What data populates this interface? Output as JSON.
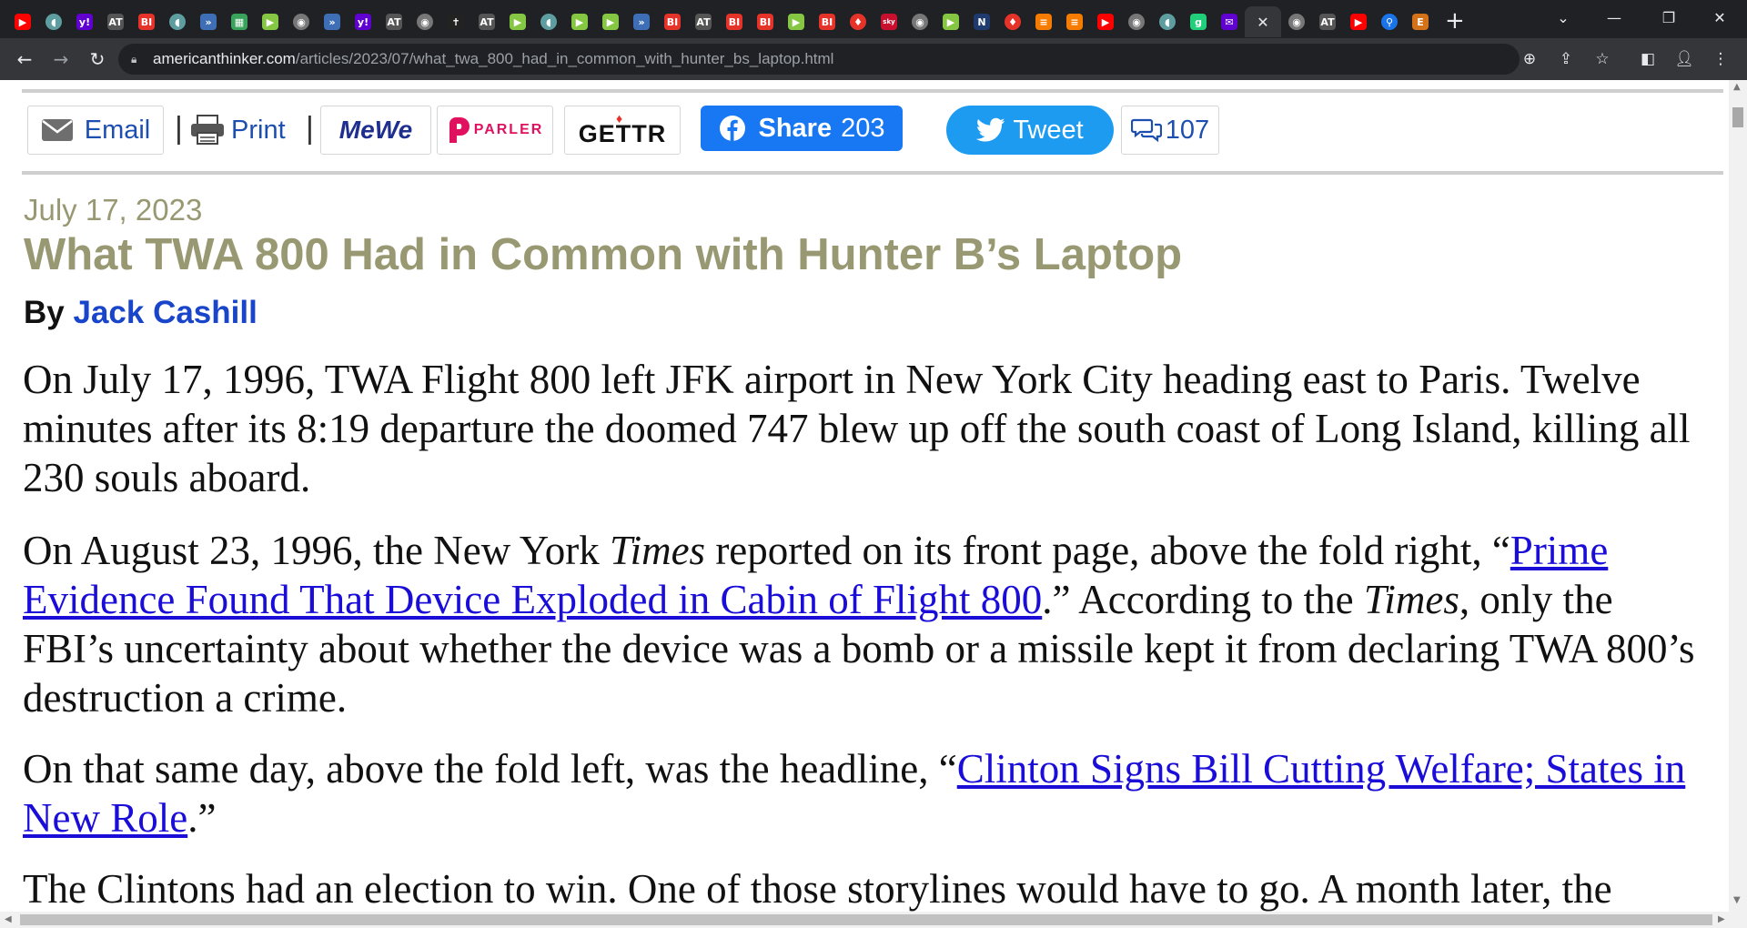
{
  "browser": {
    "tabs": [
      {
        "icon": "youtube-icon",
        "glyph": "▶",
        "color": "#ff0000",
        "round": false
      },
      {
        "icon": "shield-icon",
        "glyph": "◖",
        "color": "#5f9ea0",
        "round": true
      },
      {
        "icon": "yahoo-icon",
        "glyph": "y!",
        "color": "#6001d2",
        "round": false
      },
      {
        "icon": "american-thinker-icon",
        "glyph": "AT",
        "color": "#555555",
        "round": false
      },
      {
        "icon": "business-insider-icon",
        "glyph": "BI",
        "color": "#e5332a",
        "round": false
      },
      {
        "icon": "shield-icon",
        "glyph": "◖",
        "color": "#5f9ea0",
        "round": true
      },
      {
        "icon": "arrow-icon",
        "glyph": "»",
        "color": "#3e6fb6",
        "round": false
      },
      {
        "icon": "grid-icon",
        "glyph": "▦",
        "color": "#3aa35b",
        "round": false
      },
      {
        "icon": "rumble-icon",
        "glyph": "▶",
        "color": "#85c742",
        "round": false
      },
      {
        "icon": "globe-icon",
        "glyph": "◉",
        "color": "#777777",
        "round": true
      },
      {
        "icon": "arrow-icon",
        "glyph": "»",
        "color": "#3e6fb6",
        "round": false
      },
      {
        "icon": "yahoo-icon",
        "glyph": "y!",
        "color": "#6001d2",
        "round": false
      },
      {
        "icon": "american-thinker-icon",
        "glyph": "AT",
        "color": "#555555",
        "round": false
      },
      {
        "icon": "globe-icon",
        "glyph": "◉",
        "color": "#777777",
        "round": true
      },
      {
        "icon": "person-icon",
        "glyph": "✝",
        "color": "#222222",
        "round": false
      },
      {
        "icon": "american-thinker-icon",
        "glyph": "AT",
        "color": "#555555",
        "round": false
      },
      {
        "icon": "rumble-icon",
        "glyph": "▶",
        "color": "#85c742",
        "round": false
      },
      {
        "icon": "shield-icon",
        "glyph": "◖",
        "color": "#5f9ea0",
        "round": true
      },
      {
        "icon": "rumble-icon",
        "glyph": "▶",
        "color": "#85c742",
        "round": false
      },
      {
        "icon": "rumble-icon",
        "glyph": "▶",
        "color": "#85c742",
        "round": false
      },
      {
        "icon": "arrow-icon",
        "glyph": "»",
        "color": "#3e6fb6",
        "round": false
      },
      {
        "icon": "business-insider-icon",
        "glyph": "BI",
        "color": "#e5332a",
        "round": false
      },
      {
        "icon": "american-thinker-icon",
        "glyph": "AT",
        "color": "#555555",
        "round": false
      },
      {
        "icon": "business-insider-icon",
        "glyph": "BI",
        "color": "#e5332a",
        "round": false
      },
      {
        "icon": "business-insider-icon",
        "glyph": "BI",
        "color": "#e5332a",
        "round": false
      },
      {
        "icon": "rumble-icon",
        "glyph": "▶",
        "color": "#85c742",
        "round": false
      },
      {
        "icon": "business-insider-icon",
        "glyph": "BI",
        "color": "#e5332a",
        "round": false
      },
      {
        "icon": "gettr-icon",
        "glyph": "♦",
        "color": "#e5332a",
        "round": true
      },
      {
        "icon": "sky-news-icon",
        "glyph": "sky",
        "color": "#c8102e",
        "round": false
      },
      {
        "icon": "globe-icon",
        "glyph": "◉",
        "color": "#777777",
        "round": true
      },
      {
        "icon": "rumble-icon",
        "glyph": "▶",
        "color": "#85c742",
        "round": false
      },
      {
        "icon": "news-icon",
        "glyph": "N",
        "color": "#1e3a6e",
        "round": false
      },
      {
        "icon": "gettr-icon",
        "glyph": "♦",
        "color": "#e5332a",
        "round": true
      },
      {
        "icon": "bookmark-icon",
        "glyph": "≡",
        "color": "#f57c00",
        "round": false
      },
      {
        "icon": "bookmark-icon",
        "glyph": "≡",
        "color": "#f57c00",
        "round": false
      },
      {
        "icon": "youtube-icon",
        "glyph": "▶",
        "color": "#ff0000",
        "round": false
      },
      {
        "icon": "globe-icon",
        "glyph": "◉",
        "color": "#777777",
        "round": true
      },
      {
        "icon": "shield-icon",
        "glyph": "◖",
        "color": "#5f9ea0",
        "round": true
      },
      {
        "icon": "gab-icon",
        "glyph": "g",
        "color": "#21cf7a",
        "round": false
      },
      {
        "icon": "mail-icon",
        "glyph": "✉",
        "color": "#6001d2",
        "round": false
      }
    ],
    "tabs_after": [
      {
        "icon": "globe-icon",
        "glyph": "◉",
        "color": "#777777",
        "round": true
      },
      {
        "icon": "american-thinker-icon",
        "glyph": "AT",
        "color": "#555555",
        "round": false
      },
      {
        "icon": "youtube-icon",
        "glyph": "▶",
        "color": "#ff0000",
        "round": false
      },
      {
        "icon": "search-icon",
        "glyph": "⚲",
        "color": "#1a73e8",
        "round": true
      },
      {
        "icon": "epoch-icon",
        "glyph": "E",
        "color": "#d4721a",
        "round": false
      }
    ],
    "active_tab_close": "✕",
    "new_tab": "+",
    "url_host": "americanthinker.com",
    "url_path": "/articles/2023/07/what_twa_800_had_in_common_with_hunter_bs_laptop.html"
  },
  "share": {
    "email": "Email",
    "print": "Print",
    "mewe": "MeWe",
    "parler": "PARLER",
    "gettr": "GETTR",
    "facebook_label": "Share",
    "facebook_count": "203",
    "tweet": "Tweet",
    "comments_count": "107"
  },
  "article": {
    "date": "July 17, 2023",
    "title": "What TWA 800 Had in Common with Hunter B’s Laptop",
    "by": "By",
    "author": "Jack Cashill",
    "p1": "On July 17, 1996, TWA Flight 800 left JFK airport in New York City heading east to Paris. Twelve minutes after its 8:19 departure the doomed 747 blew up off the south coast of Long Island, killing all 230 souls aboard.",
    "p2_a": "On August 23, 1996, the New York ",
    "p2_times1": "Times",
    "p2_b": " reported on its front page, above the fold right, “",
    "p2_link": "Prime Evidence Found That Device Exploded in Cabin of Flight 800",
    "p2_c": ".” According to the ",
    "p2_times2": "Times",
    "p2_d": ", only the FBI’s uncertainty about whether the device was a bomb or a missile kept it from declaring TWA 800’s destruction a crime.",
    "p3_a": "On that same day, above the fold left, was the headline, “",
    "p3_link": "Clinton Signs Bill Cutting Welfare; States in New Role",
    "p3_b": ".”",
    "p4": "The Clintons had an election to win. One of those storylines would have to go. A month later, the"
  }
}
